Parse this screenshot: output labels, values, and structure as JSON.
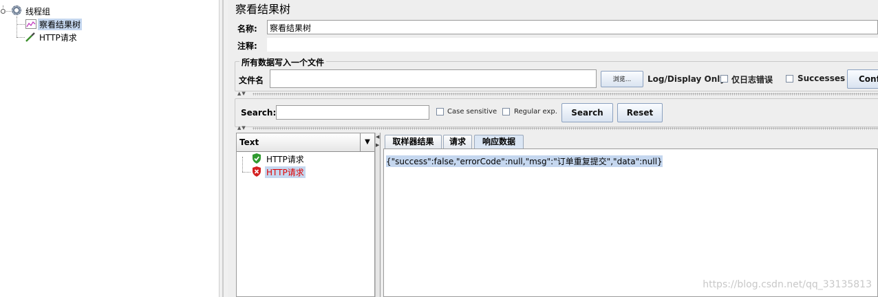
{
  "tree": {
    "items": [
      {
        "label": "线程组"
      },
      {
        "label": "察看结果树"
      },
      {
        "label": "HTTP请求"
      }
    ]
  },
  "panel": {
    "title": "察看结果树",
    "name_label": "名称:",
    "name_value": "察看结果树",
    "comment_label": "注释:",
    "file_group_title": "所有数据写入一个文件",
    "filename_label": "文件名",
    "filename_value": "",
    "browse_label": "浏览...",
    "log_display_label": "Log/Display Only:",
    "errors_only_label": "仅日志错误",
    "successes_label": "Successes",
    "configure_label": "Confi"
  },
  "search": {
    "label": "Search:",
    "value": "",
    "case_sensitive_label": "Case sensitive",
    "regular_exp_label": "Regular exp.",
    "search_button": "Search",
    "reset_button": "Reset"
  },
  "results": {
    "renderer_selected": "Text",
    "items": [
      {
        "label": "HTTP请求",
        "status": "success"
      },
      {
        "label": "HTTP请求",
        "status": "error"
      }
    ],
    "tabs": [
      {
        "label": "取样器结果"
      },
      {
        "label": "请求"
      },
      {
        "label": "响应数据"
      }
    ],
    "response_text": "{\"success\":false,\"errorCode\":null,\"msg\":\"订单重复提交\",\"data\":null}"
  },
  "watermark": "https://blog.csdn.net/qq_33135813",
  "colors": {
    "selection": "#c5d7ef",
    "error_text": "#e00000",
    "success_icon": "#2f9a2f",
    "error_icon": "#d42020",
    "panel_bg": "#eeeeee"
  }
}
